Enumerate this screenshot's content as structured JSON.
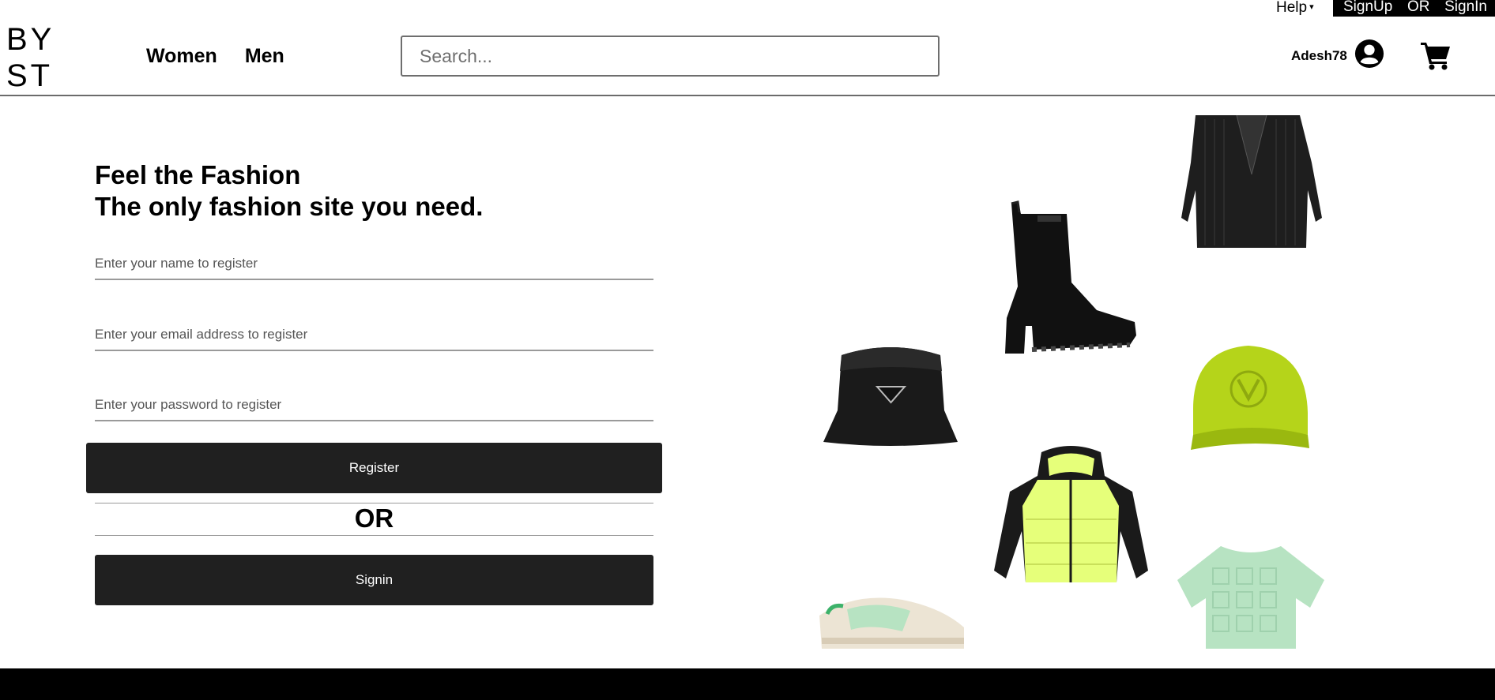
{
  "topbar": {
    "help_label": "Help",
    "signup_label": "SignUp",
    "or_label": "OR",
    "signin_label": "SignIn"
  },
  "header": {
    "logo_line1": "BY",
    "logo_line2": "ST",
    "nav": [
      {
        "label": "Women"
      },
      {
        "label": "Men"
      }
    ],
    "search_placeholder": "Search...",
    "username": "Adesh78",
    "user_icon": "account-circle-icon",
    "cart_icon": "shopping-cart-icon"
  },
  "hero": {
    "title_line1": "Feel the Fashion",
    "title_line2": "The only fashion site you need."
  },
  "form": {
    "name_placeholder": "Enter your name to register",
    "email_placeholder": "Enter your email address to register",
    "password_placeholder": "Enter your password to register",
    "register_label": "Register",
    "or_label": "OR",
    "signin_label": "Signin"
  },
  "products": [
    {
      "name": "pinstripe blazer"
    },
    {
      "name": "black ankle boot"
    },
    {
      "name": "black bucket hat"
    },
    {
      "name": "lime baseball cap"
    },
    {
      "name": "neon puffer jacket"
    },
    {
      "name": "mint sneaker"
    },
    {
      "name": "mint crop top"
    }
  ],
  "colors": {
    "button_bg": "#202020",
    "lime": "#b5d41a",
    "neon": "#e6ff7a",
    "mint": "#b7e3c2"
  }
}
